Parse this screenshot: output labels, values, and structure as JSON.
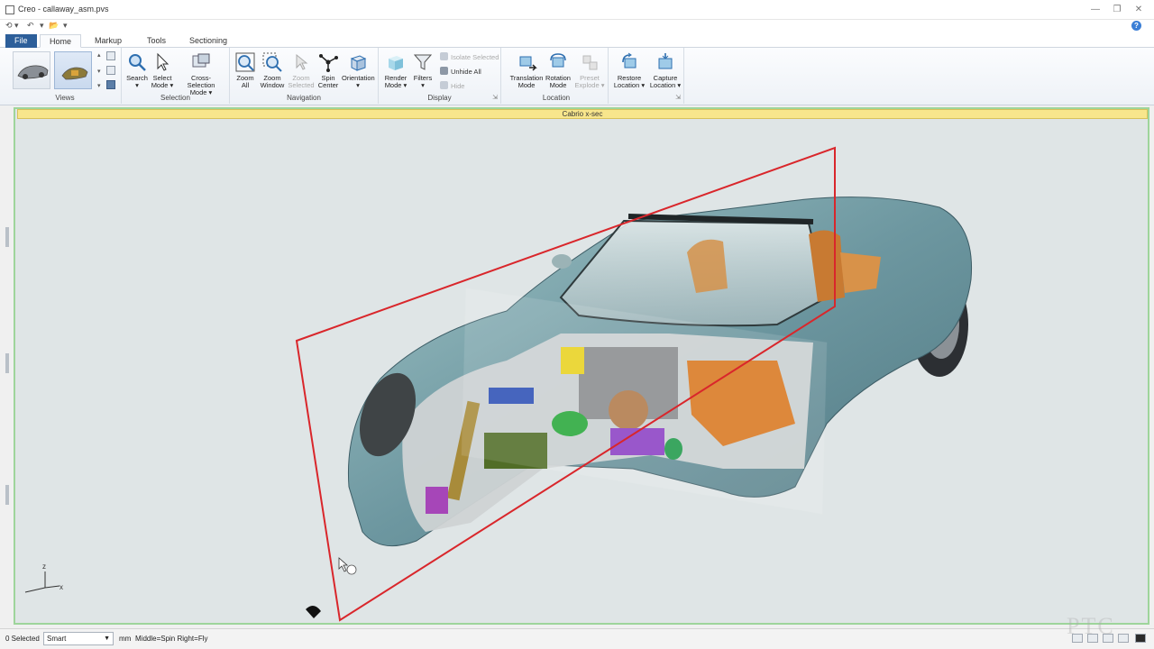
{
  "window": {
    "title": "Creo - callaway_asm.pvs",
    "controls": [
      "—",
      "❐",
      "✕"
    ]
  },
  "qat": [
    "⟲ ▾",
    "↶",
    "▾",
    "📂",
    "▾"
  ],
  "tabs": {
    "file": "File",
    "items": [
      "Home",
      "Markup",
      "Tools",
      "Sectioning"
    ],
    "active": "Home"
  },
  "ribbon": {
    "views": {
      "label": "Views"
    },
    "selection": {
      "label": "Selection",
      "buttons": [
        {
          "line1": "Search",
          "line2": "▾"
        },
        {
          "line1": "Select",
          "line2": "Mode ▾"
        },
        {
          "line1": "Cross-Selection",
          "line2": "Mode ▾"
        }
      ]
    },
    "navigation": {
      "label": "Navigation",
      "buttons": [
        {
          "line1": "Zoom",
          "line2": "All"
        },
        {
          "line1": "Zoom",
          "line2": "Window"
        },
        {
          "line1": "Zoom",
          "line2": "Selected"
        },
        {
          "line1": "Spin",
          "line2": "Center"
        },
        {
          "line1": "Orientation",
          "line2": "▾"
        }
      ]
    },
    "display": {
      "label": "Display",
      "buttons": [
        {
          "line1": "Render",
          "line2": "Mode ▾"
        },
        {
          "line1": "Filters",
          "line2": "▾"
        }
      ],
      "small": [
        "Isolate Selected",
        "Unhide All",
        "Hide"
      ]
    },
    "location": {
      "label": "Location",
      "buttons": [
        {
          "line1": "Translation",
          "line2": "Mode"
        },
        {
          "line1": "Rotation",
          "line2": "Mode"
        },
        {
          "line1": "Preset",
          "line2": "Explode ▾"
        }
      ]
    },
    "capture": {
      "buttons": [
        {
          "line1": "Restore",
          "line2": "Location ▾"
        },
        {
          "line1": "Capture",
          "line2": "Location ▾"
        }
      ]
    }
  },
  "section_bar": "Cabrio x-sec",
  "triad": {
    "z": "z",
    "x": "x"
  },
  "status": {
    "selected": "0 Selected",
    "filter": "Smart",
    "units": "mm",
    "mouse": "Middle=Spin  Right=Fly"
  },
  "watermark": "PTC",
  "colors": {
    "accent": "#2d5f9a",
    "viewport_bg": "#dfe5e6",
    "section_plane": "#d9262b",
    "car_body": "#6f98a0",
    "section_bar": "#f8e68c"
  }
}
